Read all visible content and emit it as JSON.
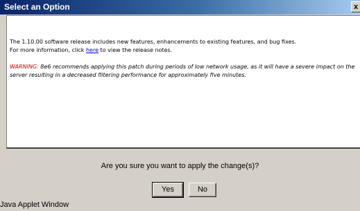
{
  "window": {
    "title": "Select an Option",
    "close_label": "x"
  },
  "message": {
    "line1": "The 1.10.00 software release includes new features, enhancements to existing features, and bug fixes.",
    "line2_before": "For more information, click ",
    "link_text": "here",
    "line2_after": " to view the release notes.",
    "warning_label": "WARNING:",
    "warning_text": " 8e6 recommends applying this patch during periods of low network usage, as it will have a severe impact on the server resulting in a decreased filtering performance for approximately five minutes."
  },
  "dialog": {
    "question": "Are you sure you want to apply the change(s)?",
    "yes_label": "Yes",
    "no_label": "No"
  },
  "status_bar": {
    "text": "Java Applet Window"
  }
}
